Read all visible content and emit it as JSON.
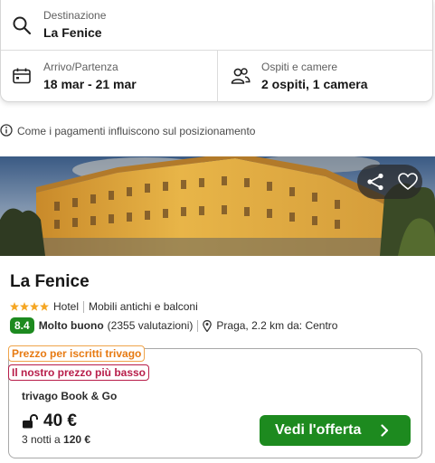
{
  "search": {
    "destination_label": "Destinazione",
    "destination_value": "La Fenice",
    "dates_label": "Arrivo/Partenza",
    "dates_value": "18 mar - 21 mar",
    "guests_label": "Ospiti e camere",
    "guests_value": "2 ospiti, 1 camera"
  },
  "info_line": "Come i pagamenti influiscono sul posizionamento",
  "hotel": {
    "name": "La Fenice",
    "stars": 4,
    "type": "Hotel",
    "feature": "Mobili antichi e balconi",
    "rating_score": "8.4",
    "rating_text": "Molto buono",
    "rating_count": "(2355 valutazioni)",
    "location": "Praga, 2.2 km da: Centro"
  },
  "offer": {
    "tag_members": "Prezzo per iscritti trivago",
    "tag_lowest": "Il nostro prezzo più basso",
    "provider": "trivago Book & Go",
    "price": "40 €",
    "nights_text": "3 notti a",
    "total": "120 €",
    "cta_label": "Vedi l'offerta"
  },
  "icons": {
    "search": "search-icon",
    "calendar": "calendar-icon",
    "guests": "guests-icon",
    "info": "info-icon",
    "share": "share-icon",
    "favorite": "heart-icon",
    "star": "star-icon",
    "pin": "map-pin-icon",
    "lock": "unlocked-padlock-icon",
    "chevron": "chevron-right-icon"
  },
  "colors": {
    "accent_green": "#1d8a1f",
    "star_orange": "#f5a623",
    "tag_orange": "#e77a12",
    "tag_red": "#b81e4a"
  }
}
